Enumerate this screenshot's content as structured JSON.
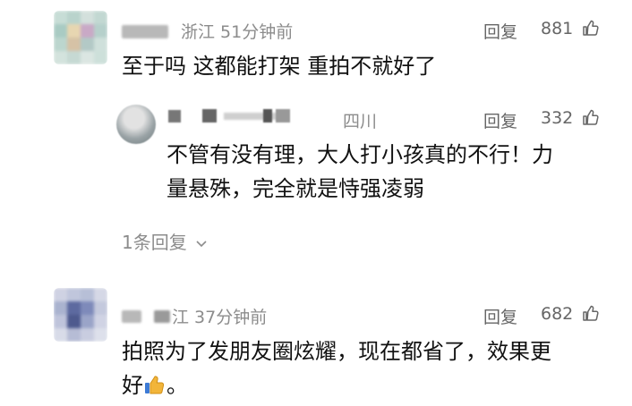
{
  "comments": [
    {
      "username": "",
      "location_time": "浙江 51分钟前",
      "reply_label": "回复",
      "likes": "881",
      "text": "至于吗 这都能打架 重拍不就好了"
    },
    {
      "username": "",
      "location_time": "江 37分钟前",
      "reply_label": "回复",
      "likes": "682",
      "text_line1": "拍照为了发朋友圈炫耀，现在都省了，效果更",
      "text_line2": "好",
      "text_tail": "。"
    }
  ],
  "reply": {
    "username": "",
    "location": "四川",
    "reply_label": "回复",
    "likes": "332",
    "text_line1": "不管有没有理，大人打小孩真的不行！力",
    "text_line2": "量悬殊，完全就是恃强凌弱"
  },
  "more_replies": "1条回复",
  "icons": {
    "like": "thumbs-up-icon",
    "expand": "chevron-down-icon",
    "emoji": "thumbs-up-emoji"
  },
  "colors": {
    "meta": "#8c8c8c",
    "text": "#111111",
    "emoji": "#f2b53a"
  }
}
